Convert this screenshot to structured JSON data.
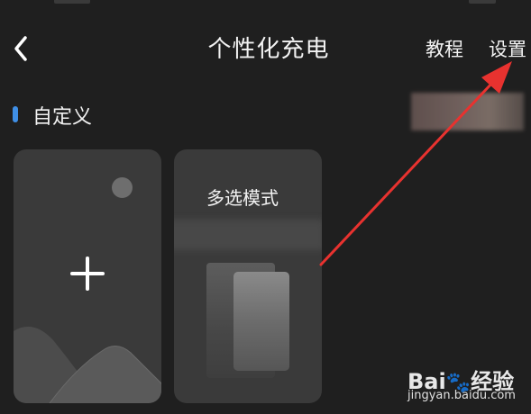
{
  "header": {
    "title": "个性化充电",
    "tutorial_label": "教程",
    "settings_label": "设置"
  },
  "section": {
    "title": "自定义"
  },
  "cards": {
    "multi_select_title": "多选模式"
  },
  "watermark": {
    "logo": "Bai",
    "logo_suffix": "经验",
    "url": "jingyan.baidu.com"
  },
  "colors": {
    "background": "#1f1f1f",
    "card": "#3a3a3a",
    "accent": "#3f8fe6",
    "annotation_arrow": "#e8322f"
  }
}
